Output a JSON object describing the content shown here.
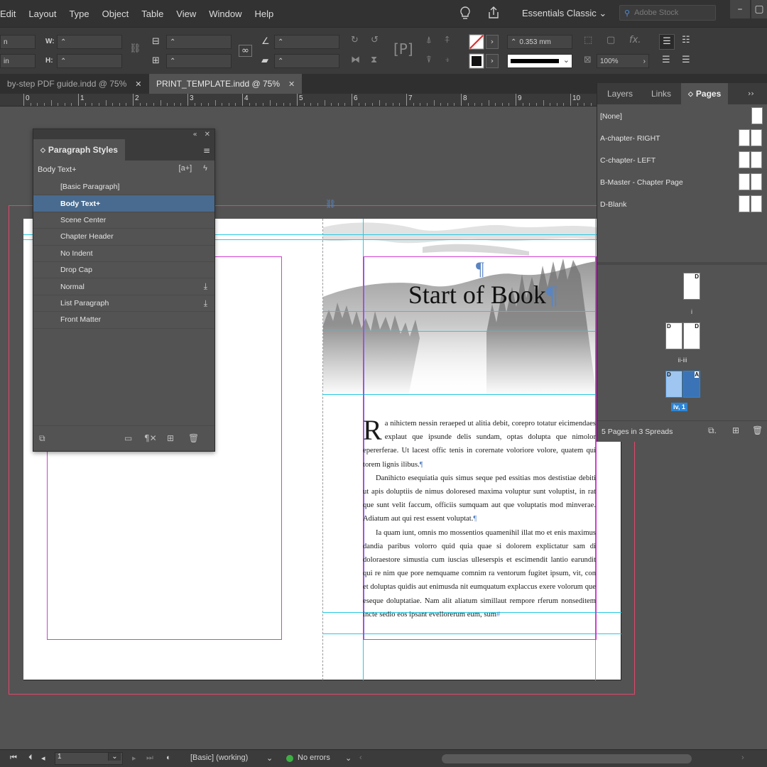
{
  "menubar": {
    "items": [
      "Edit",
      "Layout",
      "Type",
      "Object",
      "Table",
      "View",
      "Window",
      "Help"
    ],
    "workspace": "Essentials Classic",
    "search_placeholder": "Adobe Stock"
  },
  "controlbar": {
    "x_label": "n",
    "y_label": "in",
    "w_label": "W:",
    "h_label": "H:",
    "stroke_weight": "0.353 mm",
    "scale_pct": "100%"
  },
  "tabs": [
    {
      "label": "by-step PDF guide.indd @ 75%",
      "active": false
    },
    {
      "label": "PRINT_TEMPLATE.indd @ 75%",
      "active": true
    }
  ],
  "ruler": {
    "numbers": [
      "0",
      "1",
      "2",
      "3",
      "4",
      "5",
      "6",
      "7",
      "8",
      "9",
      "10"
    ]
  },
  "document": {
    "title_text": "Start of Book",
    "pilcrow": "¶",
    "dropcap": "R",
    "paragraphs": [
      "a nihictem nessin reraeped ut alitia debit, corepro totatur eicimendaes explaut que ipsunde delis sundam, optas dolupta que nimolor epererferae. Ut lacest offic tenis in corernate voloriore volore, quatem qui torem lignis ilibus.",
      "Danihicto esequiatia quis simus seque ped essitias mos destistiae debiti ut apis doluptiis de nimus doloresed maxima voluptur sunt voluptist, in rat que sunt velit faccum, officiis sumquam aut que voluptatis mod minverae. Adiatum aut qui rest essent voluptat.",
      "Ia quam iunt, omnis mo mossentios quamenihil illat mo et enis maximus dandia paribus volorro quid quia quae si dolorem explictatur sam di doloraestore simustia cum iuscias ulleserspis et escimendit lantio earundit qui re nim que pore nemquame comnim ra ventorum fugitet ipsum, vit, con et doluptas quidis aut enimusda nit eumquatum explaccus exere volorum que eseque doluptatiae. Nam alit aliatum simillaut rempore rferum nonseditem incte sedio eos ipsant evellorerum eum, sum"
    ],
    "end_mark": "#"
  },
  "paragraph_styles": {
    "panel_title": "Paragraph Styles",
    "current_style": "Body Text+",
    "items": [
      {
        "label": "[Basic Paragraph]",
        "selected": false,
        "cc": false
      },
      {
        "label": "Body Text+",
        "selected": true,
        "cc": false
      },
      {
        "label": "Scene Center",
        "selected": false,
        "cc": false
      },
      {
        "label": "Chapter Header",
        "selected": false,
        "cc": false
      },
      {
        "label": "No Indent",
        "selected": false,
        "cc": false
      },
      {
        "label": "Drop Cap",
        "selected": false,
        "cc": false
      },
      {
        "label": "Normal",
        "selected": false,
        "cc": true
      },
      {
        "label": "List Paragraph",
        "selected": false,
        "cc": true
      },
      {
        "label": "Front Matter",
        "selected": false,
        "cc": false
      }
    ]
  },
  "pages_panel": {
    "tabs": [
      "Layers",
      "Links",
      "Pages"
    ],
    "active_tab": "Pages",
    "masters": [
      "[None]",
      "A-chapter- RIGHT",
      "C-chapter- LEFT",
      "B-Master - Chapter Page",
      "D-Blank"
    ],
    "spreads": [
      {
        "label": "i",
        "left_letter": "",
        "right_letter": "D"
      },
      {
        "label": "ii-iii",
        "left_letter": "D",
        "right_letter": "D"
      },
      {
        "label": "iv, 1",
        "left_letter": "D",
        "right_letter": "A",
        "selected": true
      }
    ],
    "footer": "5 Pages in 3 Spreads"
  },
  "statusbar": {
    "page": "1",
    "preflight_profile": "[Basic] (working)",
    "errors": "No errors"
  },
  "colors": {
    "selection_blue": "#486b8f",
    "page_selected": "#2c85d6",
    "bleed_red": "#e0476a",
    "margin_magenta": "#d23fd2",
    "guide_cyan": "#27c9e1",
    "ok_green": "#3cb043"
  }
}
